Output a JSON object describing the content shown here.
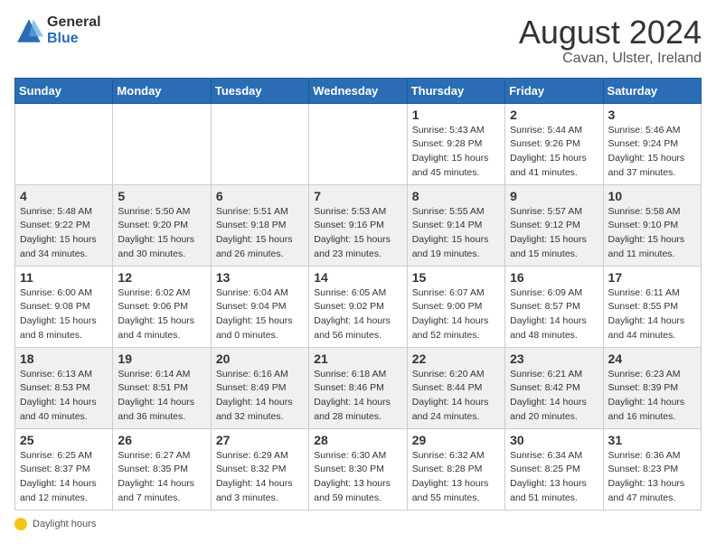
{
  "header": {
    "logo_general": "General",
    "logo_blue": "Blue",
    "month_year": "August 2024",
    "location": "Cavan, Ulster, Ireland"
  },
  "weekdays": [
    "Sunday",
    "Monday",
    "Tuesday",
    "Wednesday",
    "Thursday",
    "Friday",
    "Saturday"
  ],
  "footer": {
    "label": "Daylight hours"
  },
  "weeks": [
    [
      {
        "day": "",
        "info": ""
      },
      {
        "day": "",
        "info": ""
      },
      {
        "day": "",
        "info": ""
      },
      {
        "day": "",
        "info": ""
      },
      {
        "day": "1",
        "info": "Sunrise: 5:43 AM\nSunset: 9:28 PM\nDaylight: 15 hours\nand 45 minutes."
      },
      {
        "day": "2",
        "info": "Sunrise: 5:44 AM\nSunset: 9:26 PM\nDaylight: 15 hours\nand 41 minutes."
      },
      {
        "day": "3",
        "info": "Sunrise: 5:46 AM\nSunset: 9:24 PM\nDaylight: 15 hours\nand 37 minutes."
      }
    ],
    [
      {
        "day": "4",
        "info": "Sunrise: 5:48 AM\nSunset: 9:22 PM\nDaylight: 15 hours\nand 34 minutes."
      },
      {
        "day": "5",
        "info": "Sunrise: 5:50 AM\nSunset: 9:20 PM\nDaylight: 15 hours\nand 30 minutes."
      },
      {
        "day": "6",
        "info": "Sunrise: 5:51 AM\nSunset: 9:18 PM\nDaylight: 15 hours\nand 26 minutes."
      },
      {
        "day": "7",
        "info": "Sunrise: 5:53 AM\nSunset: 9:16 PM\nDaylight: 15 hours\nand 23 minutes."
      },
      {
        "day": "8",
        "info": "Sunrise: 5:55 AM\nSunset: 9:14 PM\nDaylight: 15 hours\nand 19 minutes."
      },
      {
        "day": "9",
        "info": "Sunrise: 5:57 AM\nSunset: 9:12 PM\nDaylight: 15 hours\nand 15 minutes."
      },
      {
        "day": "10",
        "info": "Sunrise: 5:58 AM\nSunset: 9:10 PM\nDaylight: 15 hours\nand 11 minutes."
      }
    ],
    [
      {
        "day": "11",
        "info": "Sunrise: 6:00 AM\nSunset: 9:08 PM\nDaylight: 15 hours\nand 8 minutes."
      },
      {
        "day": "12",
        "info": "Sunrise: 6:02 AM\nSunset: 9:06 PM\nDaylight: 15 hours\nand 4 minutes."
      },
      {
        "day": "13",
        "info": "Sunrise: 6:04 AM\nSunset: 9:04 PM\nDaylight: 15 hours\nand 0 minutes."
      },
      {
        "day": "14",
        "info": "Sunrise: 6:05 AM\nSunset: 9:02 PM\nDaylight: 14 hours\nand 56 minutes."
      },
      {
        "day": "15",
        "info": "Sunrise: 6:07 AM\nSunset: 9:00 PM\nDaylight: 14 hours\nand 52 minutes."
      },
      {
        "day": "16",
        "info": "Sunrise: 6:09 AM\nSunset: 8:57 PM\nDaylight: 14 hours\nand 48 minutes."
      },
      {
        "day": "17",
        "info": "Sunrise: 6:11 AM\nSunset: 8:55 PM\nDaylight: 14 hours\nand 44 minutes."
      }
    ],
    [
      {
        "day": "18",
        "info": "Sunrise: 6:13 AM\nSunset: 8:53 PM\nDaylight: 14 hours\nand 40 minutes."
      },
      {
        "day": "19",
        "info": "Sunrise: 6:14 AM\nSunset: 8:51 PM\nDaylight: 14 hours\nand 36 minutes."
      },
      {
        "day": "20",
        "info": "Sunrise: 6:16 AM\nSunset: 8:49 PM\nDaylight: 14 hours\nand 32 minutes."
      },
      {
        "day": "21",
        "info": "Sunrise: 6:18 AM\nSunset: 8:46 PM\nDaylight: 14 hours\nand 28 minutes."
      },
      {
        "day": "22",
        "info": "Sunrise: 6:20 AM\nSunset: 8:44 PM\nDaylight: 14 hours\nand 24 minutes."
      },
      {
        "day": "23",
        "info": "Sunrise: 6:21 AM\nSunset: 8:42 PM\nDaylight: 14 hours\nand 20 minutes."
      },
      {
        "day": "24",
        "info": "Sunrise: 6:23 AM\nSunset: 8:39 PM\nDaylight: 14 hours\nand 16 minutes."
      }
    ],
    [
      {
        "day": "25",
        "info": "Sunrise: 6:25 AM\nSunset: 8:37 PM\nDaylight: 14 hours\nand 12 minutes."
      },
      {
        "day": "26",
        "info": "Sunrise: 6:27 AM\nSunset: 8:35 PM\nDaylight: 14 hours\nand 7 minutes."
      },
      {
        "day": "27",
        "info": "Sunrise: 6:29 AM\nSunset: 8:32 PM\nDaylight: 14 hours\nand 3 minutes."
      },
      {
        "day": "28",
        "info": "Sunrise: 6:30 AM\nSunset: 8:30 PM\nDaylight: 13 hours\nand 59 minutes."
      },
      {
        "day": "29",
        "info": "Sunrise: 6:32 AM\nSunset: 8:28 PM\nDaylight: 13 hours\nand 55 minutes."
      },
      {
        "day": "30",
        "info": "Sunrise: 6:34 AM\nSunset: 8:25 PM\nDaylight: 13 hours\nand 51 minutes."
      },
      {
        "day": "31",
        "info": "Sunrise: 6:36 AM\nSunset: 8:23 PM\nDaylight: 13 hours\nand 47 minutes."
      }
    ]
  ]
}
